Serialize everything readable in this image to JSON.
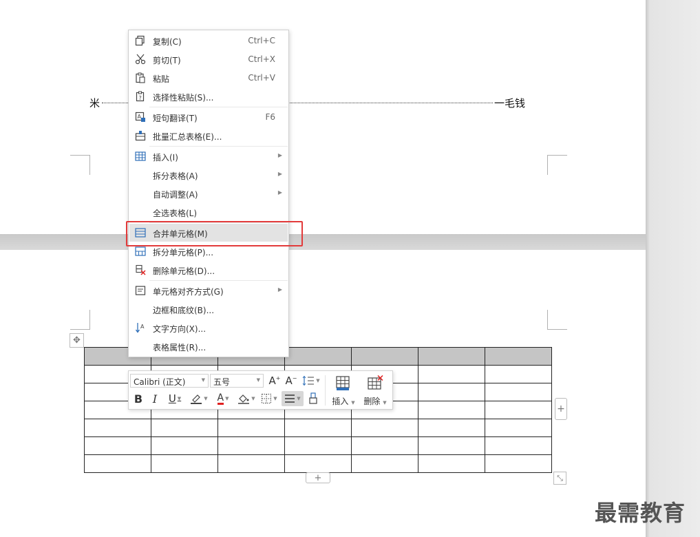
{
  "document": {
    "toc_left": "米",
    "toc_right": "一毛钱",
    "table": {
      "rows": 7,
      "cols": 7
    }
  },
  "context_menu": {
    "items": [
      {
        "label": "复制(C)",
        "shortcut": "Ctrl+C",
        "icon": "copy-icon"
      },
      {
        "label": "剪切(T)",
        "shortcut": "Ctrl+X",
        "icon": "cut-icon"
      },
      {
        "label": "粘贴",
        "shortcut": "Ctrl+V",
        "icon": "paste-icon"
      },
      {
        "label": "选择性粘贴(S)...",
        "shortcut": "",
        "icon": "paste-special-icon"
      },
      {
        "label": "短句翻译(T)",
        "shortcut": "F6",
        "icon": "translate-icon"
      },
      {
        "label": "批量汇总表格(E)...",
        "shortcut": "",
        "icon": "batch-summary-icon"
      },
      {
        "label": "插入(I)",
        "shortcut": "",
        "icon": "insert-table-icon",
        "submenu": true
      },
      {
        "label": "拆分表格(A)",
        "shortcut": "",
        "icon": "",
        "submenu": true
      },
      {
        "label": "自动调整(A)",
        "shortcut": "",
        "icon": "",
        "submenu": true
      },
      {
        "label": "全选表格(L)",
        "shortcut": "",
        "icon": ""
      },
      {
        "label": "合并单元格(M)",
        "shortcut": "",
        "icon": "merge-cells-icon",
        "highlighted": true
      },
      {
        "label": "拆分单元格(P)...",
        "shortcut": "",
        "icon": "split-cells-icon"
      },
      {
        "label": "删除单元格(D)...",
        "shortcut": "",
        "icon": "delete-cells-icon"
      },
      {
        "label": "单元格对齐方式(G)",
        "shortcut": "",
        "icon": "cell-align-icon",
        "submenu": true
      },
      {
        "label": "边框和底纹(B)...",
        "shortcut": "",
        "icon": ""
      },
      {
        "label": "文字方向(X)...",
        "shortcut": "",
        "icon": "text-direction-icon"
      },
      {
        "label": "表格属性(R)...",
        "shortcut": "",
        "icon": ""
      }
    ]
  },
  "toolbar": {
    "font_name": "Calibri (正文)",
    "font_size": "五号",
    "insert_label": "插入",
    "delete_label": "删除",
    "bold": "B",
    "italic": "I",
    "underline": "U",
    "font_color_letter": "A"
  },
  "colors": {
    "highlight_box": "#e23a3a",
    "header_fill": "#c5c5c5",
    "font_color_bar": "#e02020",
    "icon_blue": "#2f6fb8"
  },
  "watermark": "最需教育"
}
